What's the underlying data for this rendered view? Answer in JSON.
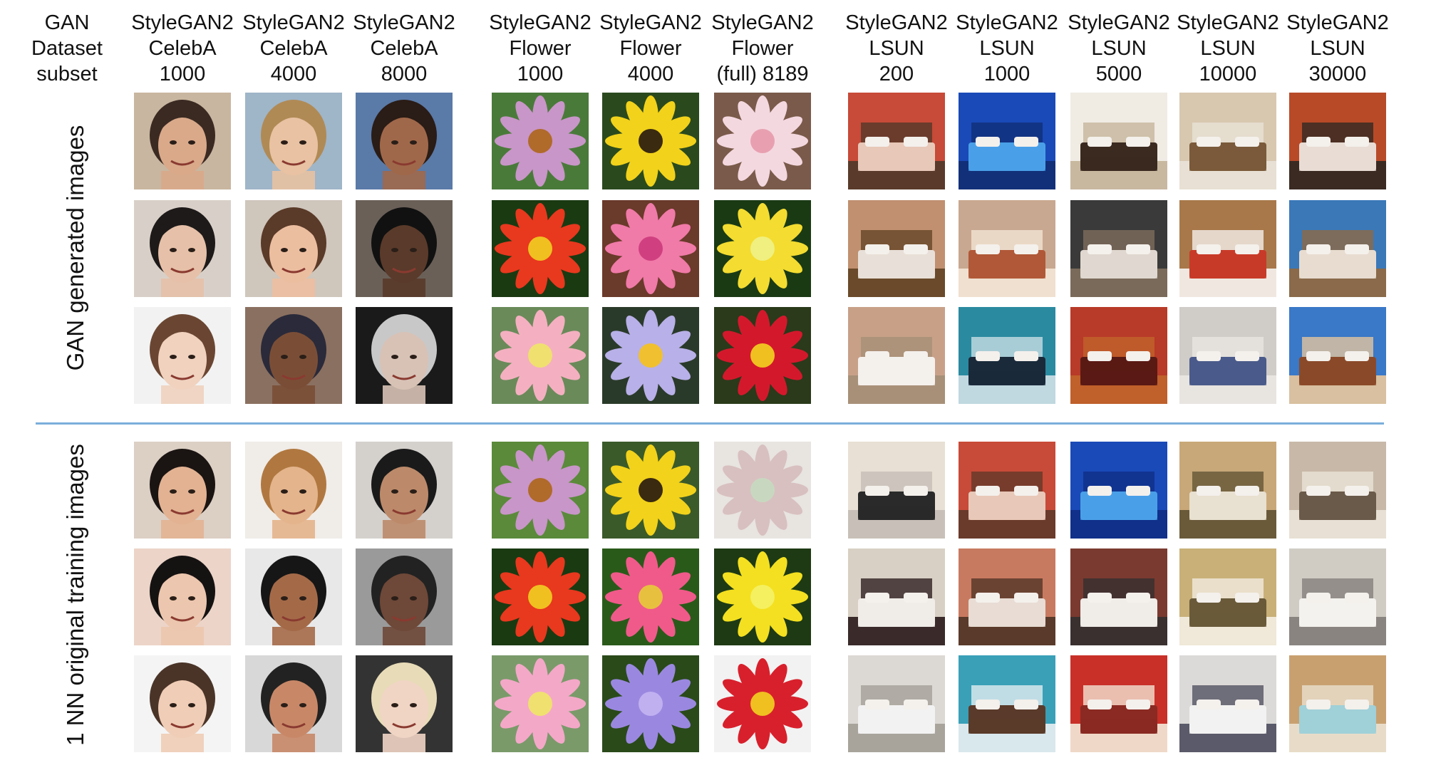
{
  "row_header": [
    "GAN",
    "Dataset",
    "subset"
  ],
  "columns": [
    {
      "id": "celeba-1000",
      "lines": [
        "StyleGAN2",
        "CelebA",
        "1000"
      ],
      "group": "face"
    },
    {
      "id": "celeba-4000",
      "lines": [
        "StyleGAN2",
        "CelebA",
        "4000"
      ],
      "group": "face"
    },
    {
      "id": "celeba-8000",
      "lines": [
        "StyleGAN2",
        "CelebA",
        "8000"
      ],
      "group": "face"
    },
    {
      "id": "flower-1000",
      "lines": [
        "StyleGAN2",
        "Flower",
        "1000"
      ],
      "group": "flower"
    },
    {
      "id": "flower-4000",
      "lines": [
        "StyleGAN2",
        "Flower",
        "4000"
      ],
      "group": "flower"
    },
    {
      "id": "flower-8189",
      "lines": [
        "StyleGAN2",
        "Flower",
        "(full) 8189"
      ],
      "group": "flower"
    },
    {
      "id": "lsun-200",
      "lines": [
        "StyleGAN2",
        "LSUN",
        "200"
      ],
      "group": "bedroom"
    },
    {
      "id": "lsun-1000",
      "lines": [
        "StyleGAN2",
        "LSUN",
        "1000"
      ],
      "group": "bedroom"
    },
    {
      "id": "lsun-5000",
      "lines": [
        "StyleGAN2",
        "LSUN",
        "5000"
      ],
      "group": "bedroom"
    },
    {
      "id": "lsun-10000",
      "lines": [
        "StyleGAN2",
        "LSUN",
        "10000"
      ],
      "group": "bedroom"
    },
    {
      "id": "lsun-30000",
      "lines": [
        "StyleGAN2",
        "LSUN",
        "30000"
      ],
      "group": "bedroom"
    }
  ],
  "sections": [
    {
      "id": "generated",
      "label": "GAN generated images"
    },
    {
      "id": "nearest-neighbor",
      "label": "1 NN original training images"
    }
  ],
  "palette": {
    "face": [
      [
        "#d9a98a",
        "#3a2a22",
        "#c9b6a0"
      ],
      [
        "#e8c2a2",
        "#b08a55",
        "#9fb5c8"
      ],
      [
        "#a0684a",
        "#2a1c16",
        "#5a7aa8"
      ],
      [
        "#e6c0a8",
        "#1e1a1a",
        "#d8d0c8"
      ],
      [
        "#ecbea0",
        "#5a3a28",
        "#cfc6bc"
      ],
      [
        "#5a3a2a",
        "#111111",
        "#6a6058"
      ],
      [
        "#f0d2bf",
        "#6a4632",
        "#f2f2f2"
      ],
      [
        "#7a4e36",
        "#2a2a3a",
        "#8a7060"
      ],
      [
        "#d8c2b6",
        "#c8c8c8",
        "#1a1a1a"
      ],
      [
        "#e2b292",
        "#1a1412",
        "#dccfc4"
      ],
      [
        "#e4b48c",
        "#b07840",
        "#f0ece8"
      ],
      [
        "#bc8a6a",
        "#1a1a1a",
        "#d4d0cc"
      ],
      [
        "#ecc6ae",
        "#151212",
        "#ecd4c8"
      ],
      [
        "#a46a48",
        "#161616",
        "#e8e8e8"
      ],
      [
        "#6e4838",
        "#222222",
        "#9a9a9a"
      ],
      [
        "#f0cdb6",
        "#4a3428",
        "#f4f4f4"
      ],
      [
        "#c88868",
        "#222222",
        "#d8d8d8"
      ],
      [
        "#f0d4c4",
        "#e8dcb8",
        "#333333"
      ]
    ],
    "flower": [
      [
        "#c896c8",
        "#b06a2a",
        "#4a7a3a"
      ],
      [
        "#f2d21a",
        "#3a2a10",
        "#2a4a1e"
      ],
      [
        "#f4d8e0",
        "#e8a0b0",
        "#7a5a4a"
      ],
      [
        "#e8381e",
        "#f0c020",
        "#1a3a12"
      ],
      [
        "#f07aa8",
        "#d04080",
        "#6a3a2a"
      ],
      [
        "#f4dc30",
        "#f0f080",
        "#1a3a14"
      ],
      [
        "#f4b0c0",
        "#f0e070",
        "#6a8a5a"
      ],
      [
        "#b8b0e8",
        "#f0c030",
        "#2a3a2a"
      ],
      [
        "#d4182c",
        "#f0c020",
        "#2a3a1a"
      ],
      [
        "#c896c8",
        "#b06a2a",
        "#5a8a3a"
      ],
      [
        "#f2d21a",
        "#3a2a10",
        "#3a5a2a"
      ],
      [
        "#d8c0c0",
        "#c8d8c0",
        "#e8e4e0"
      ],
      [
        "#e8381e",
        "#f0c020",
        "#1a3a12"
      ],
      [
        "#f05a8a",
        "#e8c040",
        "#2a5a1a"
      ],
      [
        "#f4e020",
        "#f4f060",
        "#1e3a14"
      ],
      [
        "#f4a8c8",
        "#f0e070",
        "#7a9a6a"
      ],
      [
        "#9a88e0",
        "#c0b0f0",
        "#2a4a1a"
      ],
      [
        "#d8202c",
        "#f0c020",
        "#f2f2f2"
      ]
    ],
    "bedroom": [
      [
        "#c84a38",
        "#e8c8b8",
        "#5a3a2a"
      ],
      [
        "#1a4ab8",
        "#4aa0e8",
        "#12307a"
      ],
      [
        "#f0ece4",
        "#3a2a20",
        "#c8b8a0"
      ],
      [
        "#d8c8b0",
        "#7a5a3a",
        "#e8e0d4"
      ],
      [
        "#b84a28",
        "#e8dcd4",
        "#3a2a22"
      ],
      [
        "#c09070",
        "#e8e0d8",
        "#6a4a2a"
      ],
      [
        "#c8a890",
        "#b05838",
        "#f0e0d0"
      ],
      [
        "#3a3a3a",
        "#e0d8d0",
        "#7a6a5a"
      ],
      [
        "#a8784a",
        "#c83a28",
        "#f0e8e0"
      ],
      [
        "#3a78b8",
        "#e8dcd0",
        "#8a6a4a"
      ],
      [
        "#c8a088",
        "#f4f0ec",
        "#a89078"
      ],
      [
        "#2a8aa0",
        "#1a2a3a",
        "#c0d8e0"
      ],
      [
        "#b83a28",
        "#5a1a14",
        "#c0602a"
      ],
      [
        "#d0ccc8",
        "#4a5a8a",
        "#e8e4e0"
      ],
      [
        "#3a78c8",
        "#8a4a2a",
        "#d8c0a0"
      ],
      [
        "#e8e0d4",
        "#2a2a2a",
        "#c8c0b8"
      ],
      [
        "#c84a38",
        "#e8c8b8",
        "#6a3a2a"
      ],
      [
        "#1a4ab8",
        "#4aa0e8",
        "#10308a"
      ],
      [
        "#c8a878",
        "#e8e0d0",
        "#6a5a3a"
      ],
      [
        "#c8b8a8",
        "#6a5a4a",
        "#e8e0d4"
      ],
      [
        "#d8d0c4",
        "#f0ece8",
        "#3a2a2a"
      ],
      [
        "#c87a60",
        "#e8dcd4",
        "#5a3a2a"
      ],
      [
        "#7a3a30",
        "#f0ece8",
        "#3a3030"
      ],
      [
        "#c8b078",
        "#6a5a3a",
        "#f0e8d8"
      ],
      [
        "#d0ccc4",
        "#f4f2ee",
        "#8a8480"
      ],
      [
        "#dcd8d4",
        "#f2f2f2",
        "#a8a49c"
      ],
      [
        "#3aa0b8",
        "#5a3a2a",
        "#d8e8ec"
      ],
      [
        "#c83028",
        "#8a2a22",
        "#f0d8c8"
      ],
      [
        "#dcdad8",
        "#f2f2f2",
        "#5a5a6a"
      ],
      [
        "#c8a070",
        "#a0d0d8",
        "#e8dcc8"
      ],
      [
        "#e8e4dc",
        "#a098c0",
        "#c8b890"
      ]
    ]
  }
}
